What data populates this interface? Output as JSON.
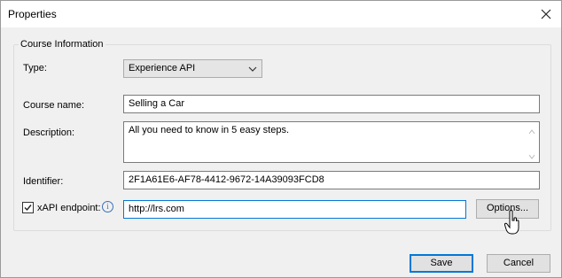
{
  "window": {
    "title": "Properties"
  },
  "group": {
    "title": "Course Information"
  },
  "form": {
    "type_label": "Type:",
    "type_value": "Experience API",
    "course_name_label": "Course name:",
    "course_name_value": "Selling a Car",
    "description_label": "Description:",
    "description_value": "All you need to know in 5 easy steps.",
    "identifier_label": "Identifier:",
    "identifier_value": "2F1A61E6-AF78-4412-9672-14A39093FCD8",
    "endpoint_label": "xAPI endpoint:",
    "endpoint_checked": true,
    "endpoint_value": "http://lrs.com",
    "info_glyph": "i",
    "options_label": "Options..."
  },
  "buttons": {
    "save": "Save",
    "cancel": "Cancel"
  },
  "colors": {
    "accent": "#0078d7",
    "info": "#3b6fb6",
    "background": "#f0f0f0"
  }
}
